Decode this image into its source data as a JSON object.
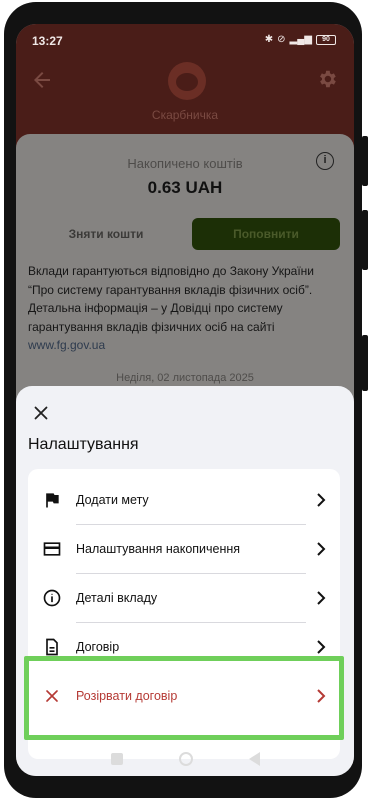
{
  "status_bar": {
    "time": "13:27",
    "battery": "90"
  },
  "header": {
    "title": "Скарбничка"
  },
  "account": {
    "balance_label": "Накопичено коштів",
    "balance_value": "0.63 UAH",
    "withdraw_label": "Зняти кошти",
    "topup_label": "Поповнити",
    "note_lines": [
      "Вклади гарантуються відповідно до Закону України",
      "“Про систему гарантування вкладів фізичних осіб”.",
      "Детальна інформація – у Довідці про систему",
      "гарантування вкладів фізичних осіб на сайті"
    ],
    "note_link": "www.fg.gov.ua",
    "date_text": "Неділя, 02 листопада 2025"
  },
  "sheet": {
    "title": "Налаштування",
    "items": [
      {
        "label": "Додати мету",
        "icon": "flag-icon"
      },
      {
        "label": "Налаштування накопичення",
        "icon": "card-icon"
      },
      {
        "label": "Деталі вкладу",
        "icon": "info-icon"
      },
      {
        "label": "Договір",
        "icon": "document-icon"
      },
      {
        "label": "Розірвати договір",
        "icon": "close-icon"
      }
    ]
  },
  "colors": {
    "danger": "#b53a35",
    "highlight": "#6fcf5a",
    "header_bg": "#4a1d18",
    "sheet_bg": "#f1f2f6"
  }
}
